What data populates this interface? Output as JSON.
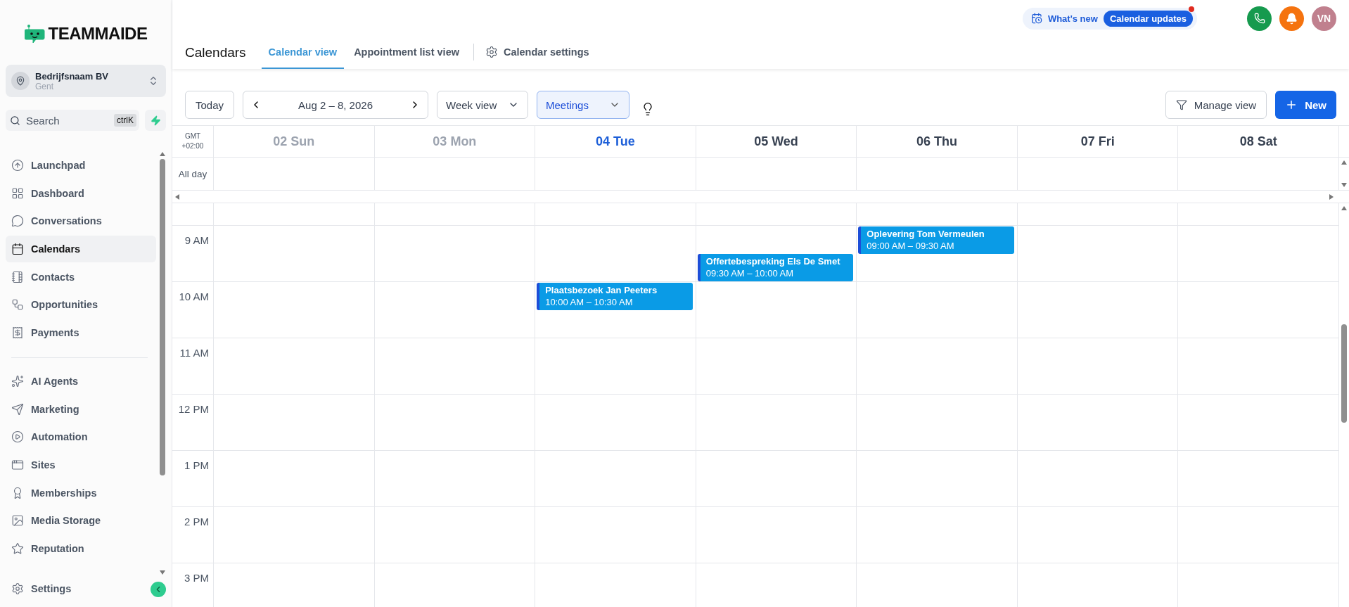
{
  "logo": {
    "text": "TEAMMAIDE"
  },
  "account": {
    "name": "Bedrijfsnaam BV",
    "location": "Gent"
  },
  "search": {
    "placeholder": "Search",
    "shortcut": "ctrlK"
  },
  "nav_groups": [
    [
      {
        "label": "Launchpad",
        "selected": false
      },
      {
        "label": "Dashboard",
        "selected": false
      },
      {
        "label": "Conversations",
        "selected": false
      },
      {
        "label": "Calendars",
        "selected": true
      },
      {
        "label": "Contacts",
        "selected": false
      },
      {
        "label": "Opportunities",
        "selected": false
      },
      {
        "label": "Payments",
        "selected": false
      }
    ],
    [
      {
        "label": "AI Agents",
        "selected": false
      },
      {
        "label": "Marketing",
        "selected": false
      },
      {
        "label": "Automation",
        "selected": false
      },
      {
        "label": "Sites",
        "selected": false
      },
      {
        "label": "Memberships",
        "selected": false
      },
      {
        "label": "Media Storage",
        "selected": false
      },
      {
        "label": "Reputation",
        "selected": false
      }
    ]
  ],
  "nav_footer": {
    "label": "Settings",
    "selected": false
  },
  "top_bar": {
    "whats_new": "What's new",
    "updates_badge": "Calendar updates",
    "avatar": "VN"
  },
  "header": {
    "title": "Calendars",
    "tabs": [
      {
        "label": "Calendar view",
        "selected": true
      },
      {
        "label": "Appointment list view",
        "selected": false
      }
    ],
    "settings_link": "Calendar settings"
  },
  "toolbar": {
    "today": "Today",
    "date_range": "Aug 2 – 8, 2026",
    "view_select": "Week view",
    "calendar_select": "Meetings",
    "manage_view": "Manage view",
    "new_button": "New"
  },
  "timezone": [
    "GMT",
    "+02:00"
  ],
  "all_day_label": "All day",
  "days": [
    {
      "label": "02 Sun",
      "kind": "past"
    },
    {
      "label": "03 Mon",
      "kind": "past"
    },
    {
      "label": "04 Tue",
      "kind": "today"
    },
    {
      "label": "05 Wed",
      "kind": "future"
    },
    {
      "label": "06 Thu",
      "kind": "future"
    },
    {
      "label": "07 Fri",
      "kind": "future"
    },
    {
      "label": "08 Sat",
      "kind": "future"
    }
  ],
  "hours": [
    {
      "label": "9 AM",
      "cells": [
        null,
        null,
        null,
        {
          "title": "Offertebespreking Els De Smet",
          "time": "09:30 AM – 10:00 AM",
          "kind": "late"
        },
        {
          "title": "Oplevering Tom Vermeulen",
          "time": "09:00 AM – 09:30 AM",
          "kind": "early"
        },
        null,
        null
      ]
    },
    {
      "label": "10 AM",
      "cells": [
        null,
        null,
        {
          "title": "Plaatsbezoek Jan Peeters",
          "time": "10:00 AM – 10:30 AM",
          "kind": "early"
        },
        null,
        null,
        null,
        null
      ]
    },
    {
      "label": "11 AM",
      "cells": [
        null,
        null,
        null,
        null,
        null,
        null,
        null
      ]
    },
    {
      "label": "12 PM",
      "cells": [
        null,
        null,
        null,
        null,
        null,
        null,
        null
      ]
    },
    {
      "label": "1 PM",
      "cells": [
        null,
        null,
        null,
        null,
        null,
        null,
        null
      ]
    },
    {
      "label": "2 PM",
      "cells": [
        null,
        null,
        null,
        null,
        null,
        null,
        null
      ]
    },
    {
      "label": "3 PM",
      "cells": [
        null,
        null,
        null,
        null,
        null,
        null,
        null
      ]
    }
  ]
}
